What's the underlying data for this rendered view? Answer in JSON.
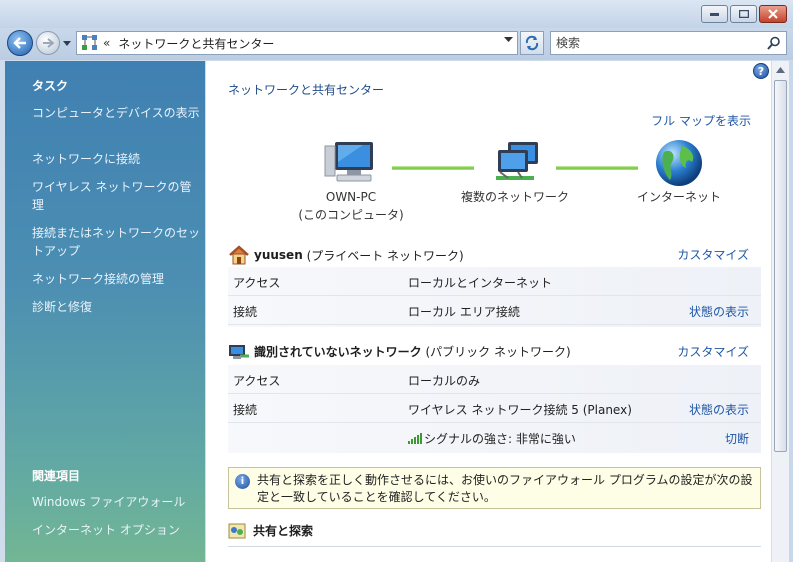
{
  "window": {
    "minimize_label": "minimize",
    "maximize_label": "maximize",
    "close_label": "close"
  },
  "address": {
    "breadcrumb_chevron": "«",
    "path": "ネットワークと共有センター",
    "search_placeholder": "検索"
  },
  "sidebar": {
    "tasks_title": "タスク",
    "tasks": [
      {
        "label": "コンピュータとデバイスの表示"
      },
      {
        "label": "ネットワークに接続"
      },
      {
        "label": "ワイヤレス ネットワークの管理"
      },
      {
        "label": "接続またはネットワークのセットアップ"
      },
      {
        "label": "ネットワーク接続の管理"
      },
      {
        "label": "診断と修復"
      }
    ],
    "related_title": "関連項目",
    "related": [
      {
        "label": "Windows ファイアウォール"
      },
      {
        "label": "インターネット オプション"
      }
    ]
  },
  "main": {
    "page_title": "ネットワークと共有センター",
    "full_map_link": "フル マップを表示",
    "map": {
      "pc_name": "OWN-PC",
      "pc_sub": "(このコンピュータ)",
      "multi_network": "複数のネットワーク",
      "internet": "インターネット"
    },
    "networks": [
      {
        "name": "yuusen",
        "type": "(プライベート ネットワーク)",
        "customize": "カスタマイズ",
        "rows": [
          {
            "key": "アクセス",
            "value": "ローカルとインターネット",
            "action": ""
          },
          {
            "key": "接続",
            "value": "ローカル エリア接続",
            "action": "状態の表示"
          }
        ]
      },
      {
        "name": "識別されていないネットワーク",
        "type": "(パブリック ネットワーク)",
        "customize": "カスタマイズ",
        "rows": [
          {
            "key": "アクセス",
            "value": "ローカルのみ",
            "action": ""
          },
          {
            "key": "接続",
            "value": "ワイヤレス ネットワーク接続 5 (Planex)",
            "action": "状態の表示"
          },
          {
            "key": "",
            "value": "シグナルの強さ: 非常に強い",
            "action": "切断"
          }
        ]
      }
    ],
    "info_text": "共有と探索を正しく動作させるには、お使いのファイアウォール プログラムの設定が次の設定と一致していることを確認してください。",
    "sharing_title": "共有と探索",
    "help_glyph": "?"
  }
}
